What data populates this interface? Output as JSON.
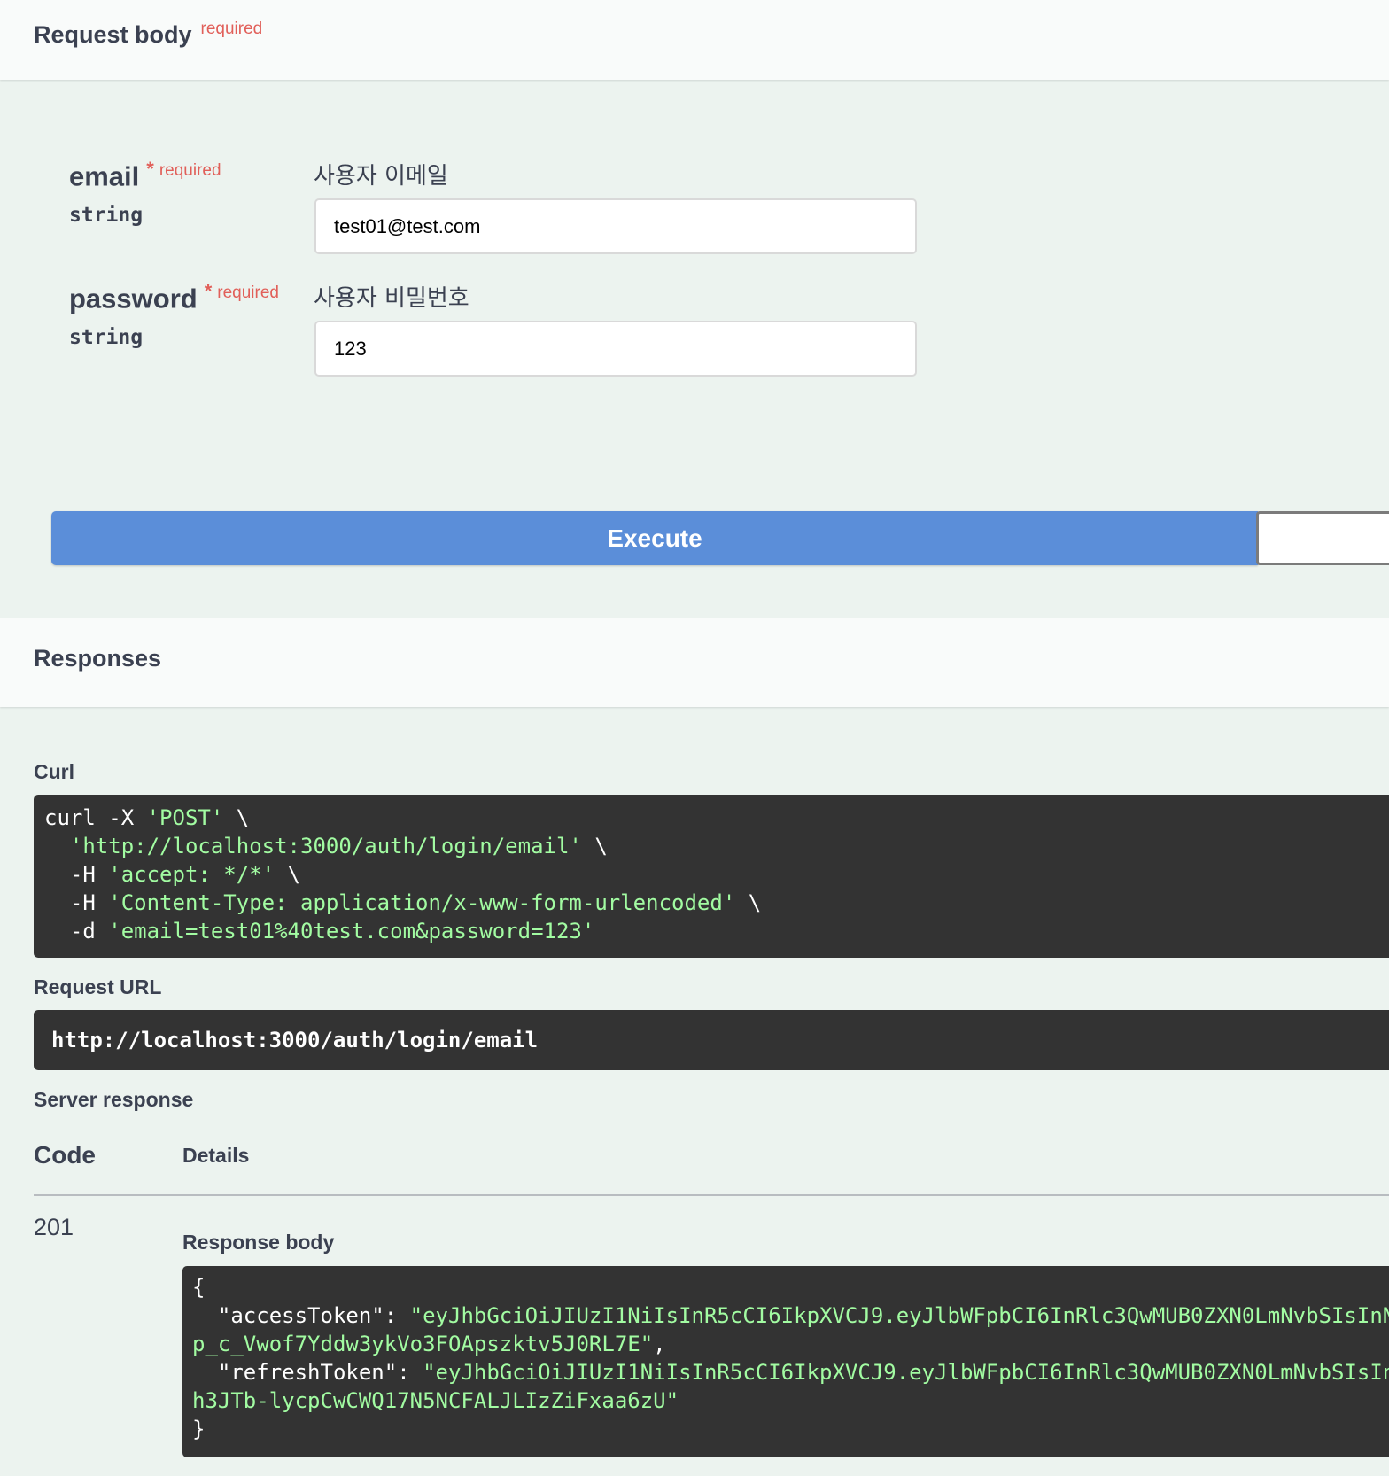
{
  "request_body": {
    "title": "Request body",
    "required_label": "required",
    "params": [
      {
        "name": "email",
        "star": "*",
        "required": "required",
        "type": "string",
        "description": "사용자 이메일",
        "value": "test01@test.com"
      },
      {
        "name": "password",
        "star": "*",
        "required": "required",
        "type": "string",
        "description": "사용자 비밀번호",
        "value": "123"
      }
    ]
  },
  "execute_label": "Execute",
  "responses": {
    "title": "Responses",
    "curl_label": "Curl",
    "curl_lines": [
      {
        "plain": "curl -X ",
        "str": "'POST'",
        "tail": " \\"
      },
      {
        "plain": "  ",
        "str": "'http://localhost:3000/auth/login/email'",
        "tail": " \\"
      },
      {
        "plain": "  -H ",
        "str": "'accept: */*'",
        "tail": " \\"
      },
      {
        "plain": "  -H ",
        "str": "'Content-Type: application/x-www-form-urlencoded'",
        "tail": " \\"
      },
      {
        "plain": "  -d ",
        "str": "'email=test01%40test.com&password=123'",
        "tail": ""
      }
    ],
    "request_url_label": "Request URL",
    "request_url": "http://localhost:3000/auth/login/email",
    "server_response_label": "Server response",
    "col_code": "Code",
    "col_details": "Details",
    "status_code": "201",
    "response_body_label": "Response body",
    "response_lines": [
      {
        "plain": "{",
        "str": ""
      },
      {
        "plain": "  \"accessToken\": ",
        "str": "\"eyJhbGciOiJIUzI1NiIsInR5cCI6IkpXVCJ9.eyJlbWFpbCI6InRlc3QwMUB0ZXN0LmNvbSIsInN"
      },
      {
        "plain": "",
        "str": "p_c_Vwof7Yddw3ykVo3FOApszktv5J0RL7E\"",
        "tail": ","
      },
      {
        "plain": "  \"refreshToken\": ",
        "str": "\"eyJhbGciOiJIUzI1NiIsInR5cCI6IkpXVCJ9.eyJlbWFpbCI6InRlc3QwMUB0ZXN0LmNvbSIsIn"
      },
      {
        "plain": "",
        "str": "h3JTb-lycpCwCWQ17N5NCFALJLIzZiFxaa6zU\""
      },
      {
        "plain": "}",
        "str": ""
      }
    ]
  }
}
